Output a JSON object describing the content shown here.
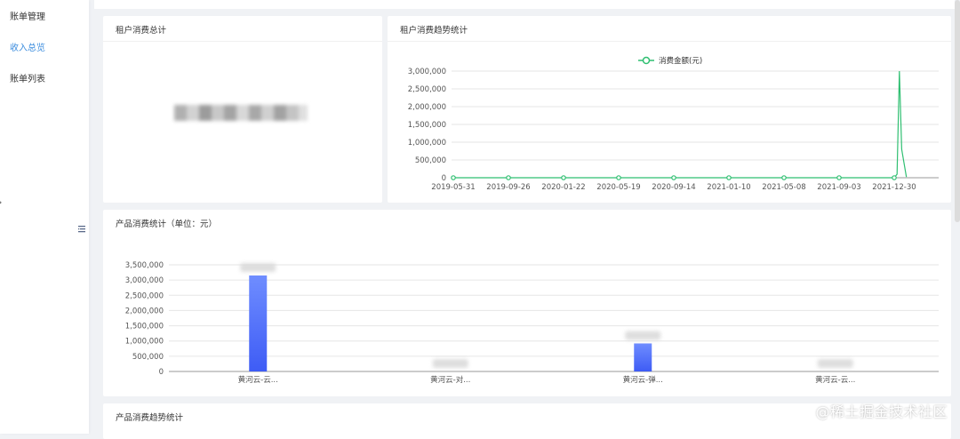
{
  "sidebar": {
    "items": [
      {
        "label": "账单管理",
        "active": false
      },
      {
        "label": "收入总览",
        "active": true
      },
      {
        "label": "账单列表",
        "active": false
      }
    ]
  },
  "cards": {
    "tenant_total": {
      "title": "租户消费总计"
    },
    "tenant_trend": {
      "title": "租户消费趋势统计"
    },
    "product_stats": {
      "title": "产品消费统计（单位：元）"
    },
    "product_trend": {
      "title": "产品消费趋势统计"
    }
  },
  "colors": {
    "accent": "#3c8dde",
    "line": "#2fbf71",
    "bar_top": "#6f8dff",
    "bar_bottom": "#3e5cf5"
  },
  "watermark": "@稀土掘金技术社区",
  "chart_data": [
    {
      "type": "line",
      "title": "",
      "legend": [
        "消费金额(元)"
      ],
      "legend_position": "top-center",
      "x_ticks": [
        "2019-05-31",
        "2019-09-26",
        "2020-01-22",
        "2020-05-19",
        "2020-09-14",
        "2021-01-10",
        "2021-05-08",
        "2021-09-03",
        "2021-12-30"
      ],
      "y_ticks": [
        "0",
        "500,000",
        "1,000,000",
        "1,500,000",
        "2,000,000",
        "2,500,000",
        "3,000,000"
      ],
      "ylim": [
        0,
        3000000
      ],
      "grid": true,
      "series": [
        {
          "name": "消费金额(元)",
          "points": [
            {
              "x": "2019-05-31",
              "y": 0
            },
            {
              "x": "2019-09-26",
              "y": 0
            },
            {
              "x": "2020-01-22",
              "y": 0
            },
            {
              "x": "2020-05-19",
              "y": 0
            },
            {
              "x": "2020-09-14",
              "y": 0
            },
            {
              "x": "2021-01-10",
              "y": 0
            },
            {
              "x": "2021-05-08",
              "y": 0
            },
            {
              "x": "2021-09-03",
              "y": 0
            },
            {
              "x": "2021-12-30",
              "y": 0
            },
            {
              "x": "2022-01-05",
              "y": 100000
            },
            {
              "x": "2022-01-10",
              "y": 3000000
            },
            {
              "x": "2022-01-15",
              "y": 800000
            },
            {
              "x": "2022-01-25",
              "y": 20000
            }
          ]
        }
      ]
    },
    {
      "type": "bar",
      "title": "",
      "categories": [
        "黄河云-云...",
        "黄河云-对...",
        "黄河云-弹...",
        "黄河云-云..."
      ],
      "values": [
        3150000,
        0,
        920000,
        0
      ],
      "y_ticks": [
        "0",
        "500,000",
        "1,000,000",
        "1,500,000",
        "2,000,000",
        "2,500,000",
        "3,000,000",
        "3,500,000"
      ],
      "ylim": [
        0,
        3500000
      ],
      "grid": true
    }
  ]
}
